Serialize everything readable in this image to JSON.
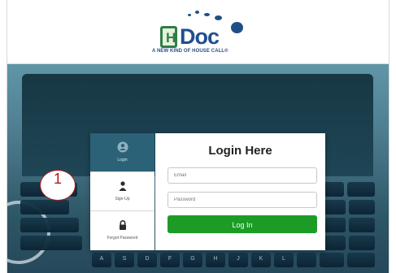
{
  "header": {
    "logo_initial": "H",
    "logo_word": "Doc",
    "logo_reg": "®",
    "logo_tagline": "A NEW KIND OF HOUSE CALL®"
  },
  "sidebar": {
    "items": [
      {
        "label": "Login",
        "icon": "user-circle-icon",
        "active": true
      },
      {
        "label": "Sign-Up",
        "icon": "person-icon",
        "active": false
      },
      {
        "label": "Forgot Password",
        "icon": "lock-icon",
        "active": false
      }
    ]
  },
  "form": {
    "title": "Login Here",
    "email_placeholder": "Email",
    "password_placeholder": "Password",
    "submit_label": "Log In"
  },
  "annotation": {
    "number": "1"
  },
  "keyboard": {
    "keys": [
      "A",
      "S",
      "D",
      "F",
      "G",
      "H",
      "J",
      "K",
      "L"
    ]
  },
  "colors": {
    "accent_teal": "#2b6278",
    "button_green": "#1c9c27",
    "brand_blue": "#214f8c",
    "callout_red": "#b3191c"
  }
}
